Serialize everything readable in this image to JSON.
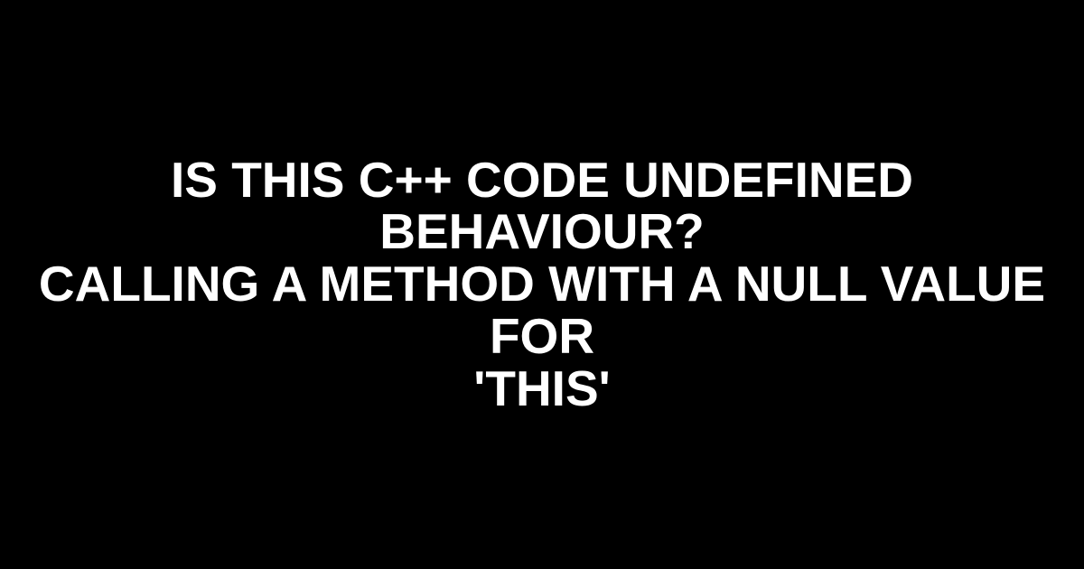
{
  "title": {
    "line1": "IS THIS C++ CODE UNDEFINED BEHAVIOUR?",
    "line2": "CALLING A METHOD WITH A NULL VALUE FOR",
    "line3": "'THIS'"
  }
}
